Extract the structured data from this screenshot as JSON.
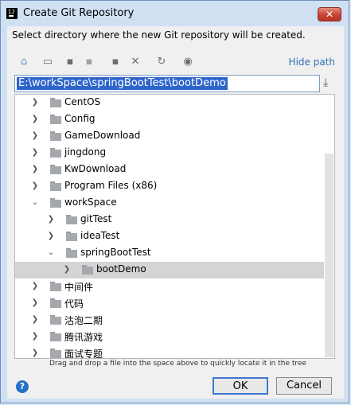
{
  "window": {
    "title": "Create Git Repository",
    "close_glyph": "✕"
  },
  "description": "Select directory where the new Git repository will be created.",
  "toolbar": {
    "icons": [
      {
        "name": "home-icon",
        "glyph": "⌂"
      },
      {
        "name": "desktop-icon",
        "glyph": "▭"
      },
      {
        "name": "project-icon",
        "glyph": "▪"
      },
      {
        "name": "module-icon",
        "glyph": "▪"
      },
      {
        "name": "new-folder-icon",
        "glyph": "▪"
      },
      {
        "name": "delete-icon",
        "glyph": "✕"
      },
      {
        "name": "refresh-icon",
        "glyph": "↻"
      },
      {
        "name": "show-hidden-icon",
        "glyph": "◉"
      }
    ],
    "hide_path": "Hide path"
  },
  "path_field": {
    "value": "E:\\workSpace\\springBootTest\\bootDemo"
  },
  "tree": {
    "rows": [
      {
        "label": "CentOS",
        "chevron": "❯"
      },
      {
        "label": "Config",
        "chevron": "❯"
      },
      {
        "label": "GameDownload",
        "chevron": "❯"
      },
      {
        "label": "jingdong",
        "chevron": "❯"
      },
      {
        "label": "KwDownload",
        "chevron": "❯"
      },
      {
        "label": "Program Files (x86)",
        "chevron": "❯"
      },
      {
        "label": "workSpace",
        "chevron": "⌄"
      },
      {
        "label": "gitTest",
        "chevron": "❯"
      },
      {
        "label": "ideaTest",
        "chevron": "❯"
      },
      {
        "label": "springBootTest",
        "chevron": "⌄"
      },
      {
        "label": "bootDemo",
        "chevron": "❯"
      },
      {
        "label": "中间件",
        "chevron": "❯"
      },
      {
        "label": "代码",
        "chevron": "❯"
      },
      {
        "label": "沽泡二期",
        "chevron": "❯"
      },
      {
        "label": "腾讯游戏",
        "chevron": "❯"
      },
      {
        "label": "面试专题",
        "chevron": "❯"
      }
    ]
  },
  "hint": "Drag and drop a file into the space above to quickly locate it in the tree",
  "buttons": {
    "help": "?",
    "ok": "OK",
    "cancel": "Cancel"
  }
}
